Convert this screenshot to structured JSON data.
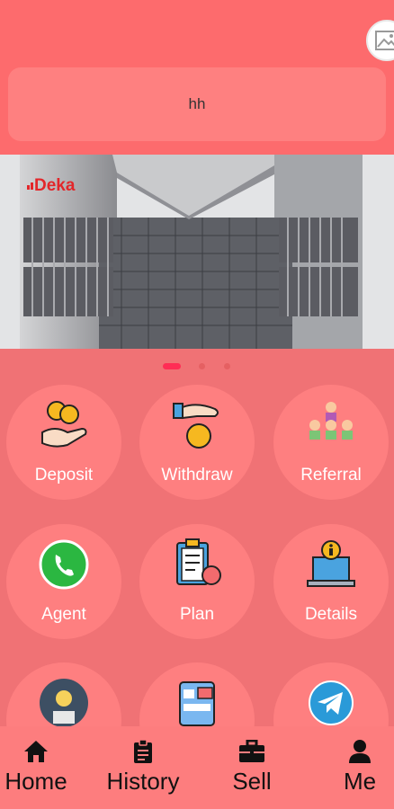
{
  "notice": {
    "text": "hh"
  },
  "banner": {
    "logo_text": "Deka",
    "slides": 3,
    "active_slide": 1
  },
  "menu": [
    {
      "label": "Deposit",
      "icon": "coins-hand-icon"
    },
    {
      "label": "Withdraw",
      "icon": "hand-coins-icon"
    },
    {
      "label": "Referral",
      "icon": "team-icon"
    },
    {
      "label": "Agent",
      "icon": "whatsapp-icon"
    },
    {
      "label": "Plan",
      "icon": "clipboard-plan-icon"
    },
    {
      "label": "Details",
      "icon": "info-monitor-icon"
    },
    {
      "label": "",
      "icon": "support-agent-icon"
    },
    {
      "label": "",
      "icon": "app-screens-icon"
    },
    {
      "label": "",
      "icon": "telegram-icon"
    }
  ],
  "tabs": [
    {
      "label": "Home",
      "icon": "home-icon"
    },
    {
      "label": "History",
      "icon": "clipboard-icon"
    },
    {
      "label": "Sell",
      "icon": "briefcase-icon"
    },
    {
      "label": "Me",
      "icon": "user-icon"
    }
  ],
  "colors": {
    "header": "#fd6b6d",
    "body": "#f07275",
    "tile": "#fe7f80",
    "active_dot": "#ff2d55"
  }
}
